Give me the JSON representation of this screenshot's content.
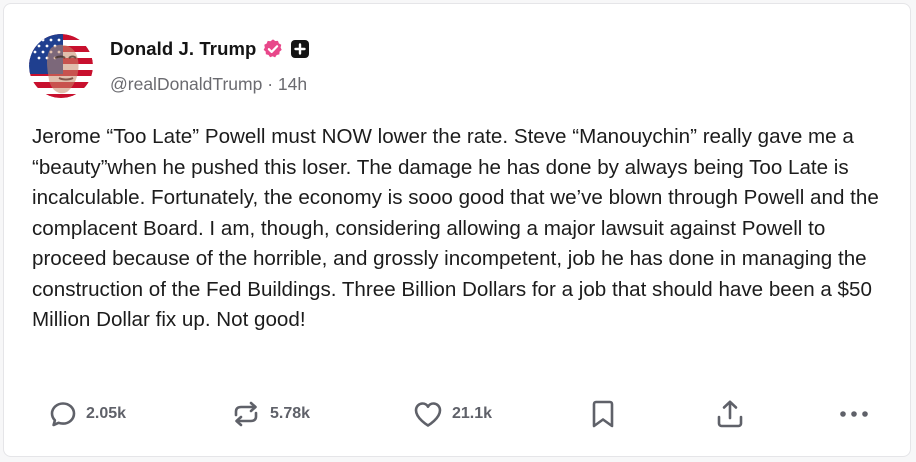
{
  "post": {
    "author": {
      "display_name": "Donald J. Trump",
      "handle": "@realDonaldTrump",
      "timestamp": "14h",
      "separator": "·",
      "verified_icon": "verified-badge-icon",
      "extra_badge_icon": "plus-badge-icon"
    },
    "text": "Jerome “Too Late” Powell must NOW lower the rate. Steve “Manouychin” really gave me a “beauty”when he pushed this loser. The damage he has done by always being Too Late is incalculable. Fortunately, the economy is sooo good that we’ve blown through Powell and the complacent Board. I am, though, considering allowing a major lawsuit against Powell to proceed because of the horrible, and grossly incompetent, job he has done in managing the construction of the Fed Buildings. Three Billion Dollars for a job that should have been a $50 Million Dollar fix up. Not good!",
    "actions": {
      "replies": {
        "icon": "reply-icon",
        "count": "2.05k"
      },
      "retruths": {
        "icon": "repost-icon",
        "count": "5.78k"
      },
      "likes": {
        "icon": "heart-icon",
        "count": "21.1k"
      },
      "bookmark": {
        "icon": "bookmark-icon"
      },
      "share": {
        "icon": "share-icon"
      },
      "more": {
        "icon": "more-icon"
      }
    }
  },
  "colors": {
    "verified_badge": "#e8478a",
    "text": "#1c1c1c",
    "muted": "#6b6b70",
    "action": "#5f6169"
  }
}
